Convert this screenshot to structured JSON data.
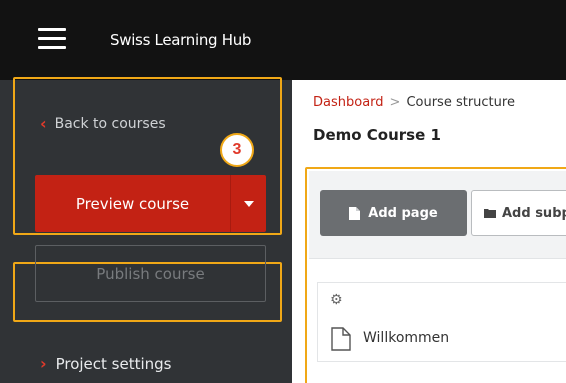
{
  "header": {
    "app_title": "Swiss Learning Hub",
    "menu_icon": "hamburger-menu-icon"
  },
  "sidebar": {
    "back_label": "Back to courses",
    "preview_label": "Preview course",
    "publish_label": "Publish course",
    "project_settings_label": "Project settings"
  },
  "tutorial": {
    "step_number": "3",
    "highlight_color": "#f0a817"
  },
  "main": {
    "breadcrumb": {
      "dashboard": "Dashboard",
      "separator": ">",
      "current": "Course structure"
    },
    "page_title": "Demo Course 1",
    "toolbar": {
      "add_page_label": "Add page",
      "add_subpage_label": "Add subp"
    },
    "pages": [
      {
        "name": "Willkommen"
      }
    ]
  },
  "colors": {
    "accent": "#c32214",
    "topbar": "#121212",
    "sidebar": "#303336"
  }
}
